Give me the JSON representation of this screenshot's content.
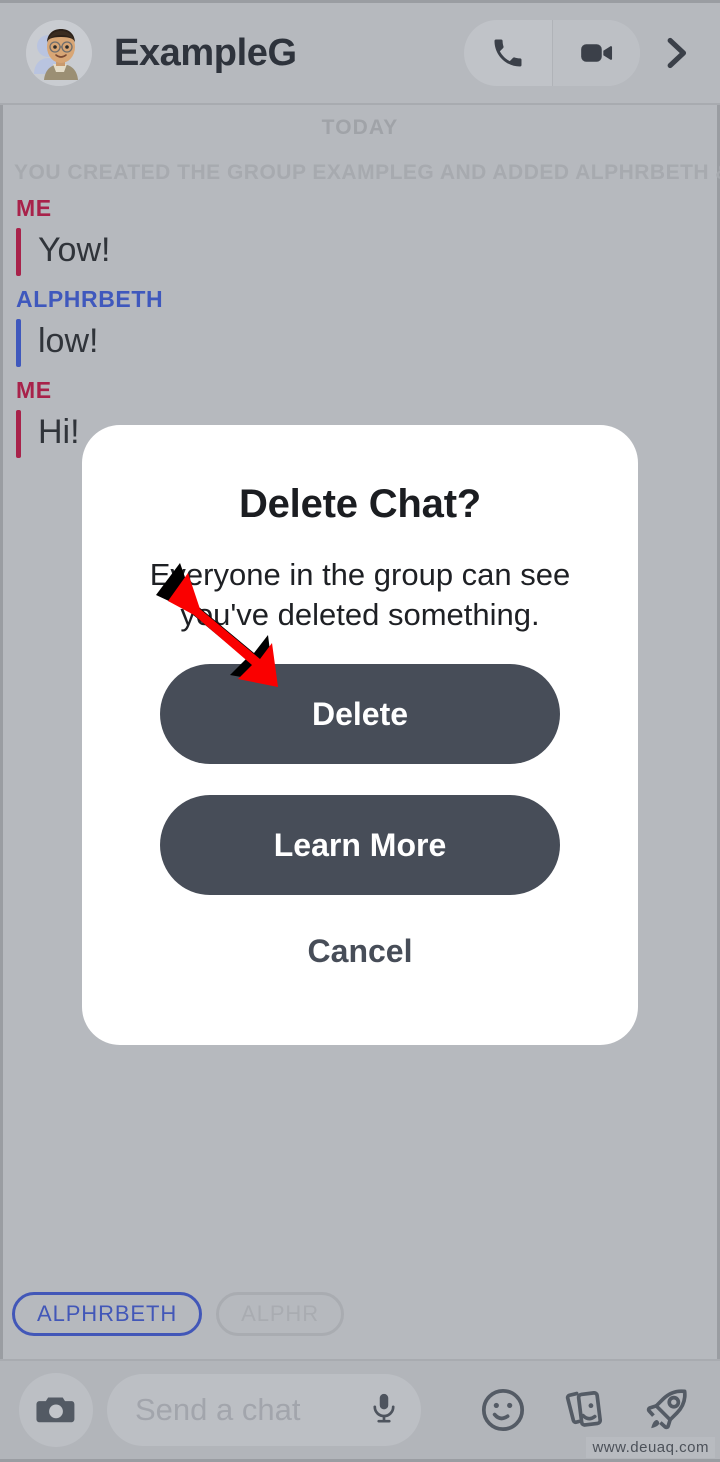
{
  "colors": {
    "app_background": "#b6b9be",
    "dialog_background": "#ffffff",
    "button_fill": "#474d58",
    "me_accent": "#a8224a",
    "other_accent": "#3f58bd",
    "arrow_red": "#fa0000",
    "chip_active": "#4257b8",
    "chip_inactive": "#a9acb1"
  },
  "header": {
    "title": "ExampleG",
    "avatar_name": "bitmoji-avatar",
    "call_icon": "phone-icon",
    "video_icon": "video-camera-icon",
    "forward_icon": "chevron-right-icon"
  },
  "conversation": {
    "day_divider": "TODAY",
    "system_note": "YOU CREATED THE GROUP EXAMPLEG AND ADDED ALPHRBETH & ALPHR",
    "messages": [
      {
        "sender": "ME",
        "side": "me",
        "text": "Yow!"
      },
      {
        "sender": "ALPHRBETH",
        "side": "other",
        "text": "low!"
      },
      {
        "sender": "ME",
        "side": "me",
        "text": "Hi!"
      }
    ]
  },
  "dialog": {
    "title": "Delete Chat?",
    "message": "Everyone in the group can see you've deleted something.",
    "delete_label": "Delete",
    "learn_more_label": "Learn More",
    "cancel_label": "Cancel"
  },
  "chips": [
    {
      "label": "ALPHRBETH",
      "state": "active"
    },
    {
      "label": "ALPHR",
      "state": "inactive"
    }
  ],
  "composer": {
    "camera_icon": "camera-icon",
    "placeholder": "Send a chat",
    "mic_icon": "microphone-icon",
    "sticker_icon": "smiley-icon",
    "cards_icon": "sticker-cards-icon",
    "rocket_icon": "rocket-icon"
  },
  "annotation": {
    "arrow_name": "red-arrow-pointing-at-delete"
  },
  "watermark": {
    "text": "www.deuaq.com"
  }
}
